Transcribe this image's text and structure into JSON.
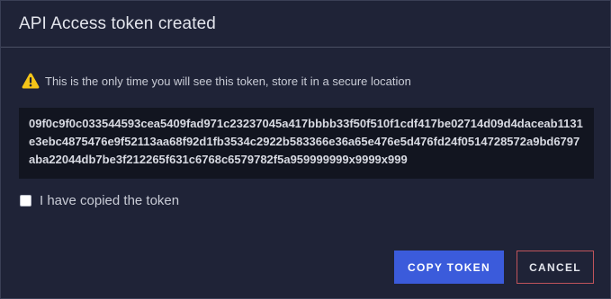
{
  "dialog": {
    "title": "API Access token created",
    "warning_icon": "warning-triangle-icon",
    "warning_text": "This is the only time you will see this token, store it in a secure location",
    "token": "09f0c9f0c033544593cea5409fad971c23237045a417bbbb33f50f510f1cdf417be02714d09d4daceab1131e3ebc4875476e9f52113aa68f92d1fb3534c2922b583366e36a65e476e5d476fd24f0514728572a9bd6797aba22044db7be3f212265f631c6768c6579782f5a959999999x9999x999",
    "checkbox_label": "I have copied the token",
    "checkbox_checked": false,
    "copy_label": "COPY TOKEN",
    "cancel_label": "CANCEL"
  },
  "colors": {
    "background": "#1f2337",
    "token_background": "#121520",
    "primary_button": "#3b5bdb",
    "cancel_border": "#c0545b",
    "warning": "#f5c518"
  }
}
